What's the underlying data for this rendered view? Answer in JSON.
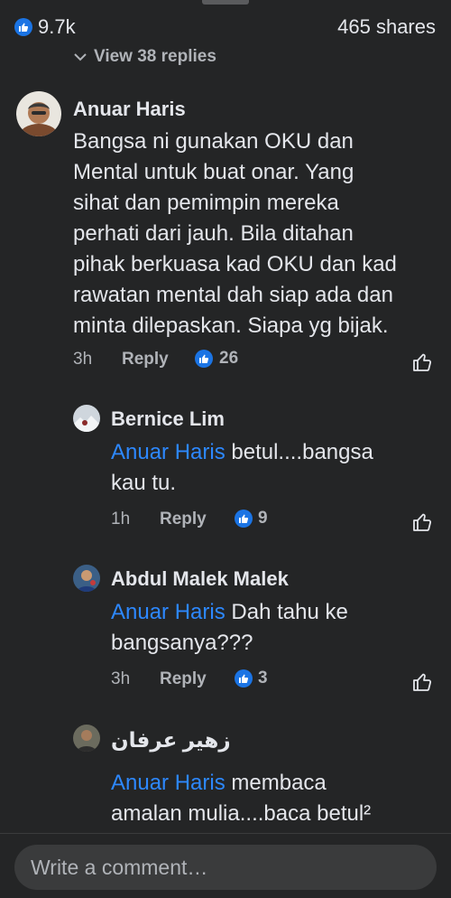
{
  "header": {
    "like_count": "9.7k",
    "shares": "465 shares"
  },
  "view_replies": "View 38 replies",
  "comment": {
    "author": "Anuar Haris",
    "text": "Bangsa ni gunakan OKU dan\nMental untuk buat onar. Yang\nsihat dan pemimpin mereka\nperhati dari jauh. Bila ditahan\npihak berkuasa kad OKU dan kad\nrawatan mental dah siap ada dan\nminta dilepaskan. Siapa yg bijak.",
    "time": "3h",
    "reply_label": "Reply",
    "reactions": "26"
  },
  "replies": [
    {
      "author": "Bernice Lim",
      "mention": "Anuar Haris",
      "text": " betul....bangsa\nkau tu.",
      "time": "1h",
      "reply_label": "Reply",
      "reactions": "9"
    },
    {
      "author": "Abdul Malek Malek",
      "mention": "Anuar Haris",
      "text": " Dah tahu ke\nbangsanya???",
      "time": "3h",
      "reply_label": "Reply",
      "reactions": "3"
    },
    {
      "author": "زهير عرفان",
      "mention": "Anuar Haris",
      "text": " membaca\namalan mulia....baca betul²"
    }
  ],
  "composer": {
    "placeholder": "Write a comment…"
  },
  "colors": {
    "background": "#242526",
    "accent": "#2d88ff",
    "badge": "#1b74e4"
  }
}
